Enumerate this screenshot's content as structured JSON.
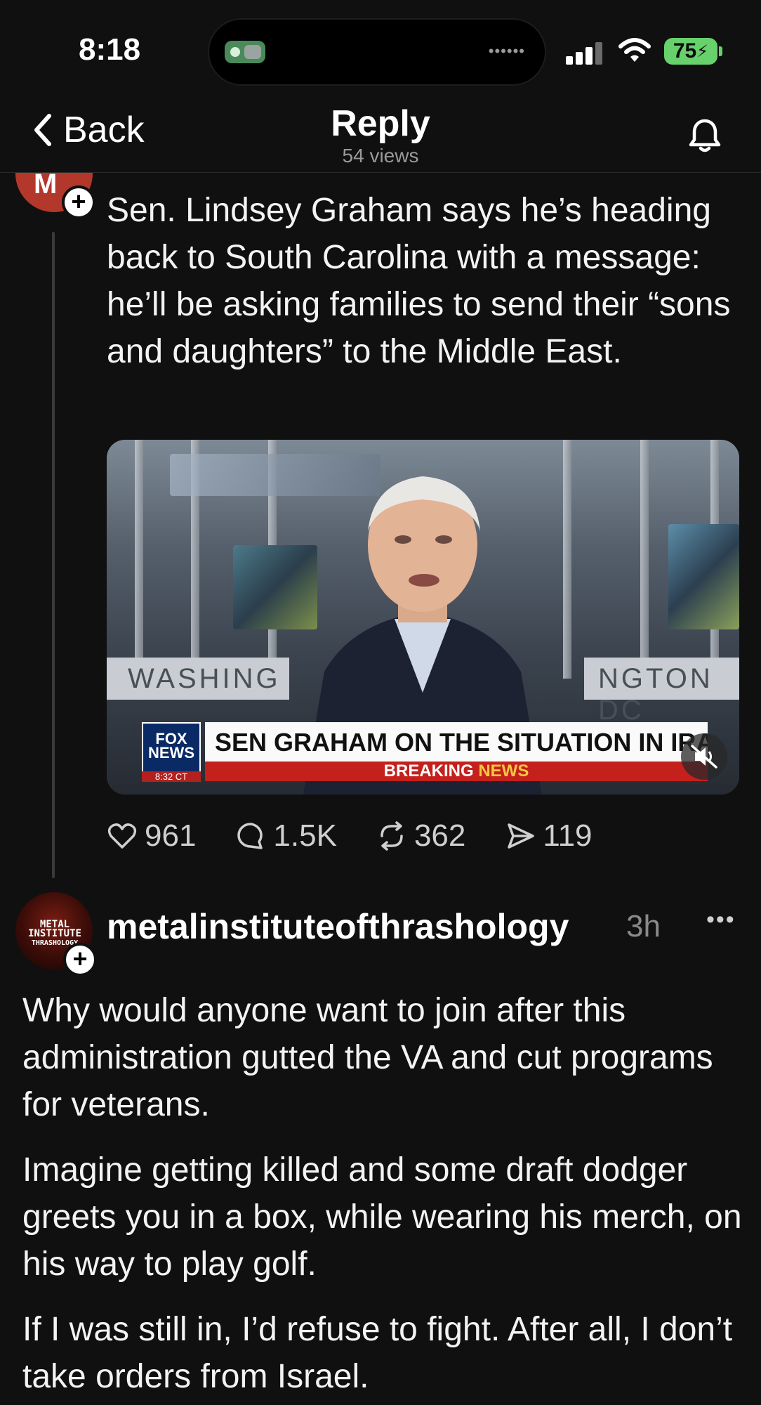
{
  "status_bar": {
    "time": "8:18",
    "battery": "75"
  },
  "nav": {
    "back_label": "Back",
    "title": "Reply",
    "views": "54 views"
  },
  "post": {
    "avatar_letter": "M",
    "text": "Sen. Lindsey Graham says he’s heading back to South Carolina with a message: he’ll be asking families to send their “sons and daughters” to the Middle East.",
    "video": {
      "location_left": "WASHING",
      "location_right": "NGTON DC",
      "logo_top": "FOX",
      "logo_bottom": "NEWS",
      "logo_time": "8:32 CT",
      "headline": "SEN GRAHAM ON THE SITUATION IN IRAN",
      "breaking": "BREAKING",
      "breaking_news": "NEWS"
    },
    "stats": {
      "likes": "961",
      "comments": "1.5K",
      "reposts": "362",
      "shares": "119"
    }
  },
  "reply": {
    "avatar_text_1": "METAL INSTITUTE",
    "avatar_text_2": "THRASHOLOGY",
    "username": "metalinstituteofthrashology",
    "timestamp": "3h",
    "paragraphs": [
      "Why would anyone want to join after this administration gutted the VA and cut programs for veterans.",
      "Imagine getting killed and some draft dodger greets you in a box, while wearing his merch, on his way to play golf.",
      "If I was still in, I’d refuse to fight. After all, I don’t take orders from Israel."
    ]
  },
  "colors": {
    "background": "#101010",
    "accent_battery": "#67d16b",
    "fox_red": "#c4201c",
    "fox_blue": "#0a2a66"
  },
  "icons": [
    "chevron-left-icon",
    "bell-icon",
    "heart-icon",
    "comment-icon",
    "repost-icon",
    "share-icon",
    "mute-icon",
    "plus-icon",
    "more-icon"
  ]
}
